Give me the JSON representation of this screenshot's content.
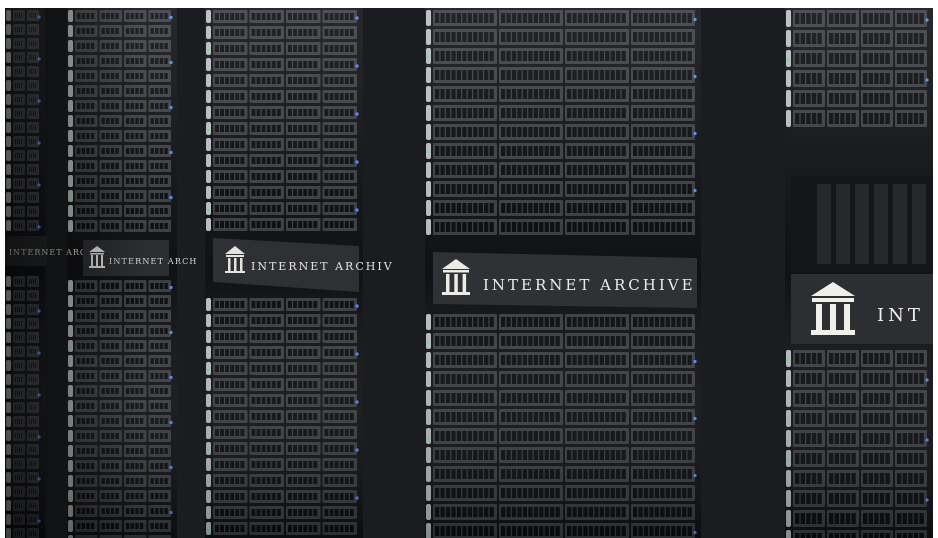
{
  "photo": {
    "subject": "server racks",
    "colors": {
      "background": "#07080a",
      "rack_frame": "#1a1c1f",
      "drive_face": "#3a3d42",
      "drive_slot": "#0b0c0e",
      "plate": "#2c2e31",
      "plate_text": "#e6e6e0",
      "handle": "#b7bbbf",
      "led_blue": "#4c8dff",
      "led_green": "#6fe07d"
    }
  },
  "labels": {
    "rack1": "INTERNET ARCH",
    "rack2": "INTERNET ARCH",
    "rack3": "INTERNET ARCHIV",
    "rack4": "INTERNET ARCHIVE",
    "rack5": "INT"
  }
}
